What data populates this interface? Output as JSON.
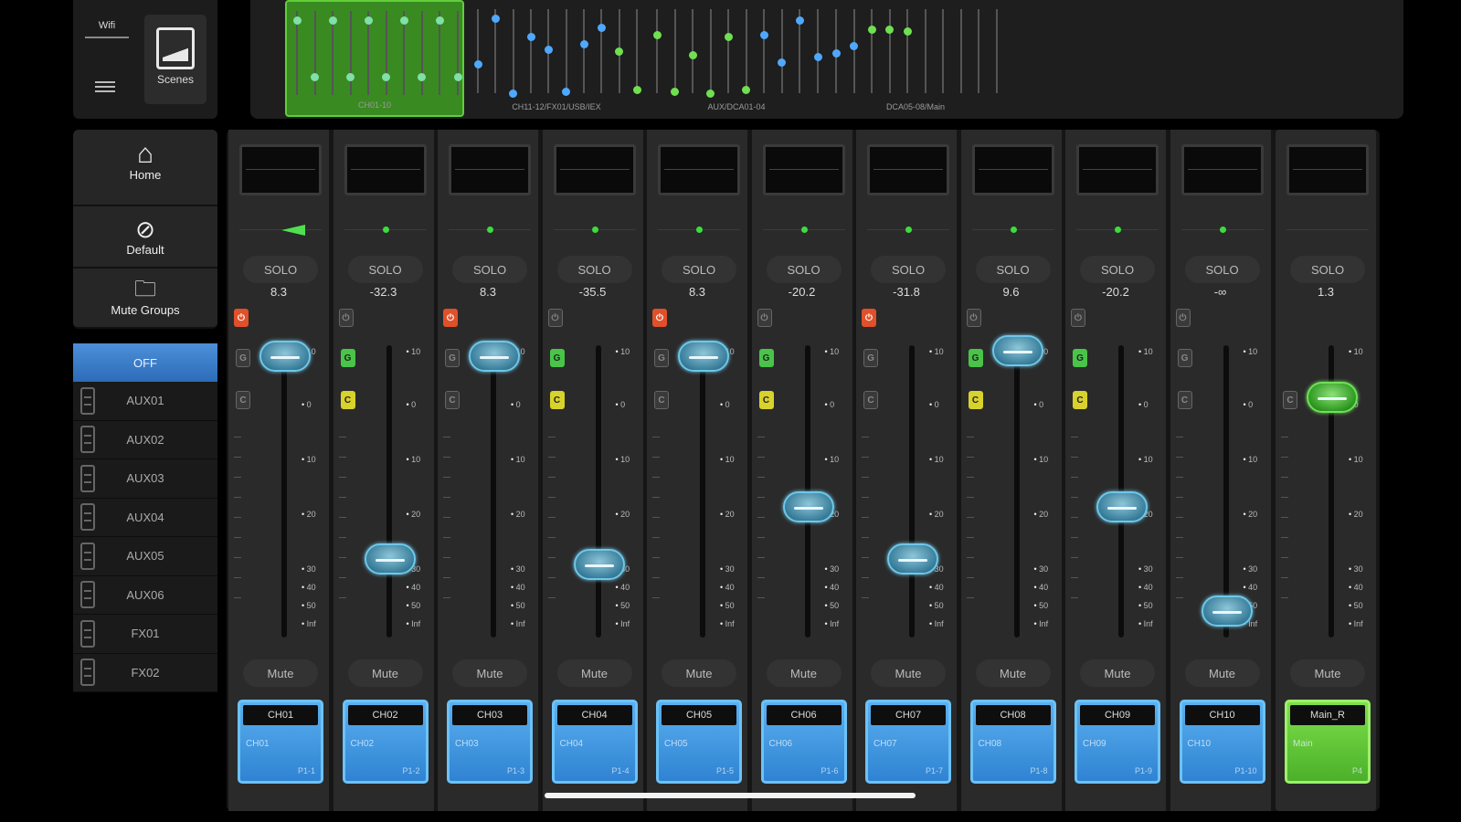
{
  "topbar": {
    "wifi_label": "Wifi",
    "scenes_label": "Scenes",
    "overview_groups": [
      {
        "label": "CH01-10",
        "active": true
      },
      {
        "label": "CH11-12/FX01/USB/IEX",
        "active": false
      },
      {
        "label": "AUX/DCA01-04",
        "active": false
      },
      {
        "label": "DCA05-08/Main",
        "active": false
      }
    ]
  },
  "nav": {
    "home_label": "Home",
    "default_label": "Default",
    "mute_groups_label": "Mute Groups",
    "mute_off_label": "OFF",
    "mute_groups": [
      "AUX01",
      "AUX02",
      "AUX03",
      "AUX04",
      "AUX05",
      "AUX06",
      "FX01",
      "FX02"
    ]
  },
  "scale_labels": [
    "10",
    "0",
    "10",
    "20",
    "30",
    "40",
    "50",
    "Inf"
  ],
  "channels": [
    {
      "solo": "SOLO",
      "db": "8.3",
      "mute": "Mute",
      "name": "CH01",
      "sub": "CH01",
      "port": "P1-1",
      "level": 0.04,
      "pan": "wedge",
      "mic": "red",
      "g": "grey",
      "c": "grey"
    },
    {
      "solo": "SOLO",
      "db": "-32.3",
      "mute": "Mute",
      "name": "CH02",
      "sub": "CH02",
      "port": "P1-2",
      "level": 0.78,
      "pan": "dot",
      "mic": "grey",
      "g": "green",
      "c": "yellow"
    },
    {
      "solo": "SOLO",
      "db": "8.3",
      "mute": "Mute",
      "name": "CH03",
      "sub": "CH03",
      "port": "P1-3",
      "level": 0.04,
      "pan": "dot",
      "mic": "red",
      "g": "grey",
      "c": "grey"
    },
    {
      "solo": "SOLO",
      "db": "-35.5",
      "mute": "Mute",
      "name": "CH04",
      "sub": "CH04",
      "port": "P1-4",
      "level": 0.8,
      "pan": "dot",
      "mic": "grey",
      "g": "green",
      "c": "yellow"
    },
    {
      "solo": "SOLO",
      "db": "8.3",
      "mute": "Mute",
      "name": "CH05",
      "sub": "CH05",
      "port": "P1-5",
      "level": 0.04,
      "pan": "dot",
      "mic": "red",
      "g": "grey",
      "c": "grey"
    },
    {
      "solo": "SOLO",
      "db": "-20.2",
      "mute": "Mute",
      "name": "CH06",
      "sub": "CH06",
      "port": "P1-6",
      "level": 0.59,
      "pan": "dot",
      "mic": "grey",
      "g": "green",
      "c": "yellow"
    },
    {
      "solo": "SOLO",
      "db": "-31.8",
      "mute": "Mute",
      "name": "CH07",
      "sub": "CH07",
      "port": "P1-7",
      "level": 0.78,
      "pan": "dot",
      "mic": "red",
      "g": "grey",
      "c": "grey"
    },
    {
      "solo": "SOLO",
      "db": "9.6",
      "mute": "Mute",
      "name": "CH08",
      "sub": "CH08",
      "port": "P1-8",
      "level": 0.02,
      "pan": "dot",
      "mic": "grey",
      "g": "green",
      "c": "yellow"
    },
    {
      "solo": "SOLO",
      "db": "-20.2",
      "mute": "Mute",
      "name": "CH09",
      "sub": "CH09",
      "port": "P1-9",
      "level": 0.59,
      "pan": "dot",
      "mic": "grey",
      "g": "green",
      "c": "yellow"
    },
    {
      "solo": "SOLO",
      "db": "-∞",
      "mute": "Mute",
      "name": "CH10",
      "sub": "CH10",
      "port": "P1-10",
      "level": 0.97,
      "pan": "dot",
      "mic": "grey",
      "g": "grey",
      "c": "grey"
    }
  ],
  "main": {
    "solo": "SOLO",
    "db": "1.3",
    "mute": "Mute",
    "name": "Main_R",
    "sub": "Main",
    "port": "P4",
    "level": 0.19,
    "c": "grey"
  },
  "colors": {
    "accent_blue": "#2f83d2",
    "accent_green": "#4cb02a",
    "knob_blue": "#6ec7e8"
  }
}
